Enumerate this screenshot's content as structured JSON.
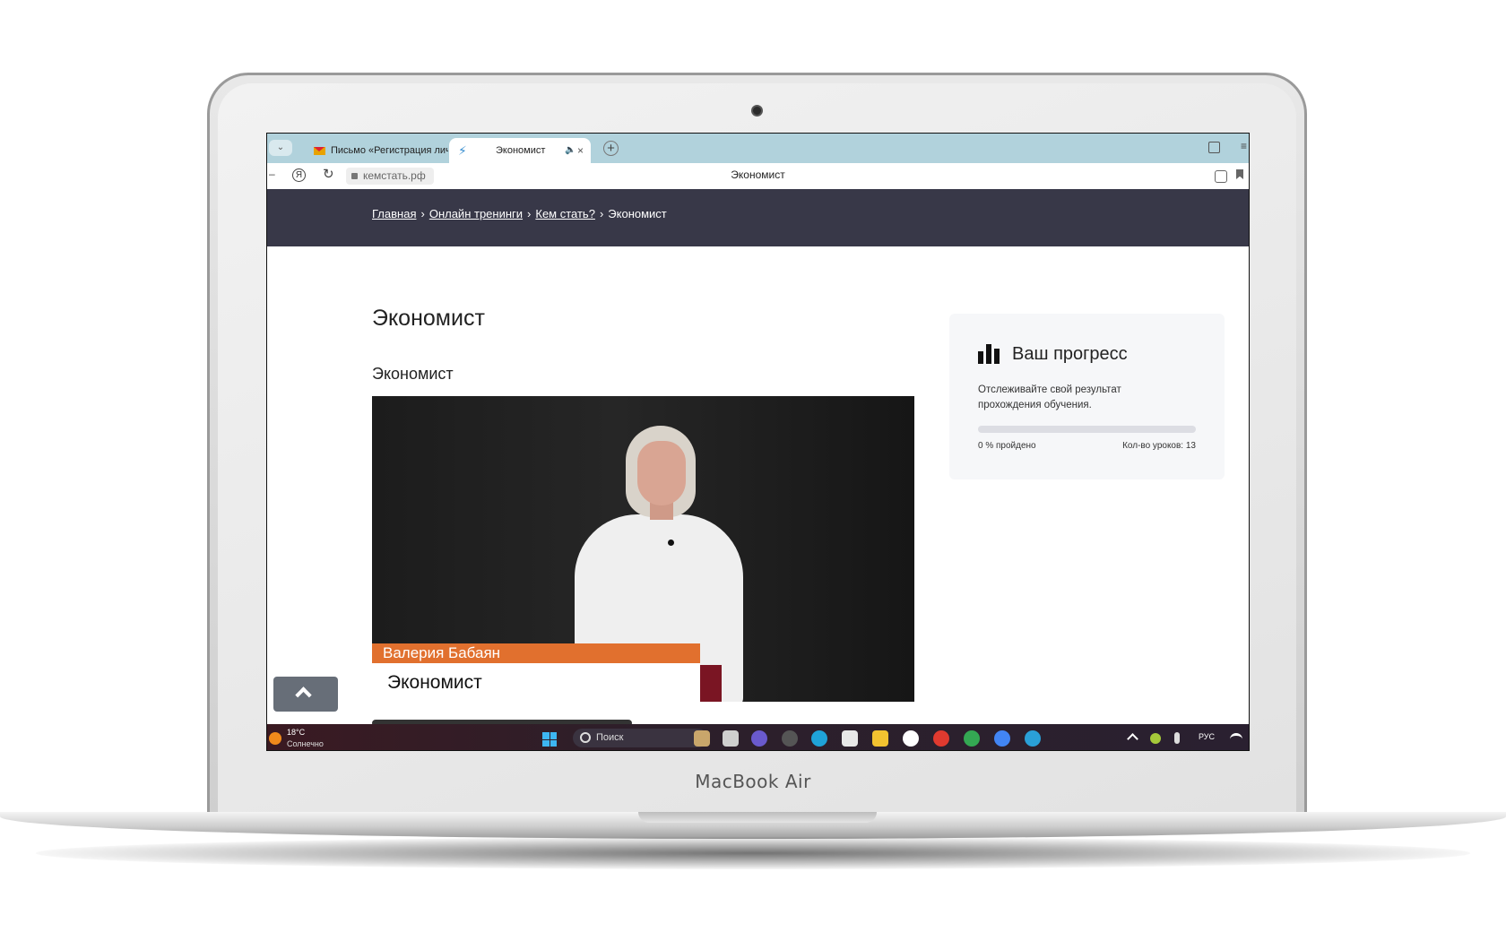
{
  "device": {
    "brand_label": "MacBook Air"
  },
  "browser": {
    "tabs": [
      {
        "label": "Письмо «Регистрация лич",
        "icon": "mail-icon"
      },
      {
        "label": "Экономист",
        "icon": "runner-icon",
        "active": true
      }
    ],
    "new_tab_label": "+",
    "nav_label": "⌄",
    "back_label": "–",
    "yandex_label": "Я",
    "reload_label": "↻",
    "url": "кемстать.рф",
    "page_title": "Экономист",
    "sound_label": "🔈",
    "close_label": "×",
    "menu_label": "≡"
  },
  "breadcrumb": {
    "items": [
      "Главная",
      "Онлайн тренинги",
      "Кем стать?",
      "Экономист"
    ],
    "separator": "›"
  },
  "content": {
    "title": "Экономист",
    "subtitle": "Экономист",
    "video": {
      "speaker_name": "Валерия Бабаян",
      "speaker_role": "Экономист"
    }
  },
  "progress": {
    "title": "Ваш прогресс",
    "description": "Отслеживайте свой результат прохождения обучения.",
    "percent": 0,
    "done_label": "0 % пройдено",
    "lessons_label": "Кол-во уроков: 13",
    "accent_color": "#e1702e"
  },
  "taskbar": {
    "weather_temp": "18°C",
    "weather_text": "Солнечно",
    "search_label": "Поиск",
    "language": "РУС",
    "apps": [
      "files-icon",
      "camera-icon",
      "zoom-icon",
      "accessibility-icon",
      "edge-icon",
      "store-icon",
      "folder-icon",
      "yandex-icon",
      "yandex-browser-icon",
      "chrome-icon",
      "chrome-profile-icon",
      "telegram-icon"
    ]
  }
}
